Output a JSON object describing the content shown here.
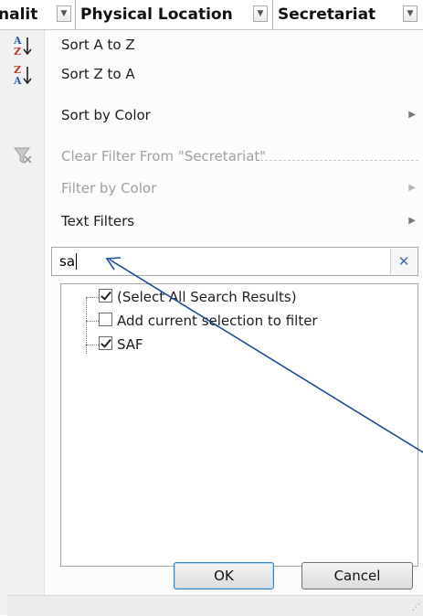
{
  "header": {
    "col1": "nalit",
    "col2": "Physical Location",
    "col3": "Secretariat",
    "dropdown_glyph": "▼"
  },
  "menu": {
    "sort_az": "Sort A to Z",
    "sort_za": "Sort Z to A",
    "sort_by_color": "Sort by Color",
    "clear_filter": "Clear Filter From \"Secretariat\"",
    "filter_by_color": "Filter by Color",
    "text_filters": "Text Filters",
    "submenu_arrow": "▶"
  },
  "search": {
    "value": "sa",
    "clear_glyph": "✕"
  },
  "list": {
    "items": [
      {
        "label": "(Select All Search Results)",
        "checked": true
      },
      {
        "label": "Add current selection to filter",
        "checked": false
      },
      {
        "label": "SAF",
        "checked": true
      }
    ]
  },
  "buttons": {
    "ok": "OK",
    "cancel": "Cancel"
  },
  "icons": {
    "sort_az": "sort-ascending-icon",
    "sort_za": "sort-descending-icon",
    "clear_filter": "clear-filter-icon"
  },
  "colors": {
    "annotation_arrow": "#1f4e96",
    "az_blue": "#2b5faa",
    "za_red": "#c0392b"
  }
}
